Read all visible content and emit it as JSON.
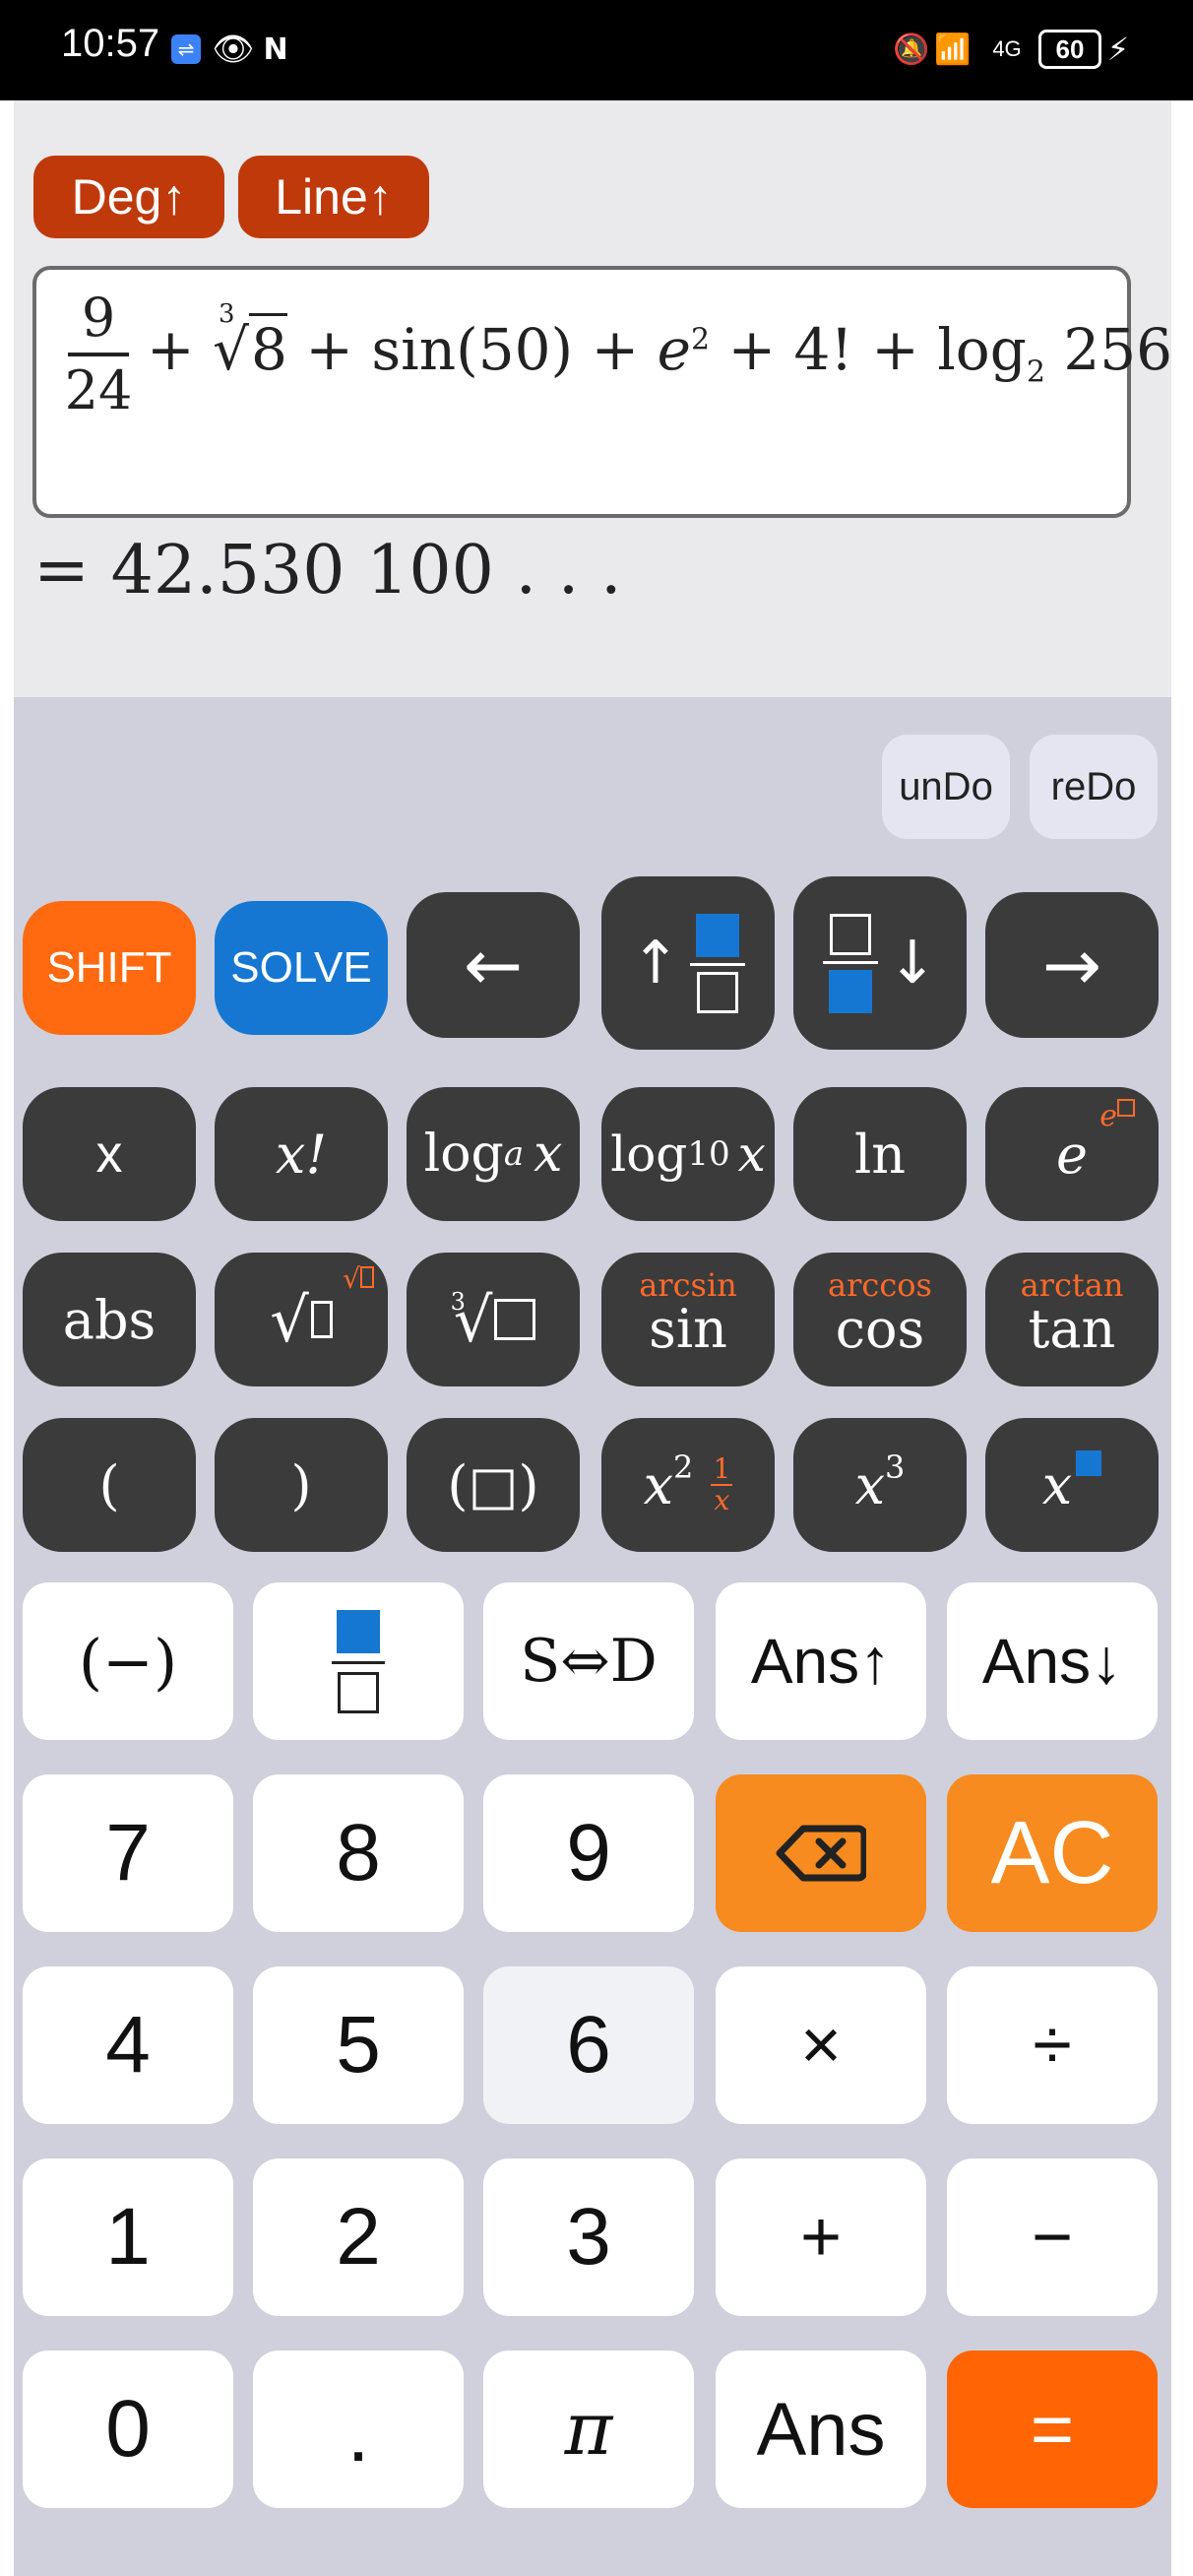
{
  "status_bar": {
    "time": "10:57",
    "battery": "60",
    "network": "4G"
  },
  "modes": {
    "angle": "Deg↑",
    "input": "Line↑"
  },
  "display": {
    "fraction_num": "9",
    "fraction_den": "24",
    "plus": "+",
    "root_index": "3",
    "root_radicand": "8",
    "sin_term": "sin(50)",
    "e_base": "e",
    "e_exp": "2",
    "factorial_term": "4!",
    "log_word": "log",
    "log_base": "2",
    "log_arg": "256",
    "result": "= 42.530 100 . . ."
  },
  "history": {
    "undo": "unDo",
    "redo": "reDo"
  },
  "sci_keys": {
    "shift": "SHIFT",
    "solve": "SOLVE",
    "left_arrow": "←",
    "right_arrow": "→",
    "up_arrow": "↑",
    "down_arrow": "↓",
    "x": "x",
    "factorial": "x!",
    "log_a": "log",
    "log_a_sub": "a",
    "log_a_x": "x",
    "log10": "log",
    "log10_sub": "10",
    "log10_x": "x",
    "ln": "ln",
    "e": "e",
    "e_sup": "e",
    "abs": "abs",
    "sqrt": "√",
    "cbrt_index": "3",
    "arcsin": "arcsin",
    "sin": "sin",
    "arccos": "arccos",
    "cos": "cos",
    "arctan": "arctan",
    "tan": "tan",
    "lparen": "(",
    "rparen": ")",
    "paren_box": "(□)",
    "x_squared": "x",
    "sq_exp": "2",
    "recip_num": "1",
    "recip_den": "x",
    "x_cubed": "x",
    "cube_exp": "3",
    "x_power": "x"
  },
  "main_keys": {
    "negate": "(−)",
    "s_d": "S⇔D",
    "ans_up": "Ans↑",
    "ans_down": "Ans↓",
    "seven": "7",
    "eight": "8",
    "nine": "9",
    "ac": "AC",
    "four": "4",
    "five": "5",
    "six": "6",
    "multiply": "×",
    "divide": "÷",
    "one": "1",
    "two": "2",
    "three": "3",
    "plus": "+",
    "minus": "−",
    "zero": "0",
    "dot": ".",
    "pi": "π",
    "ans": "Ans",
    "equals": "="
  }
}
